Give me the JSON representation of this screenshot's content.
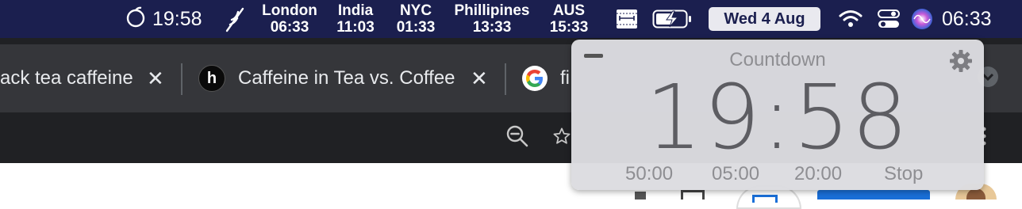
{
  "menubar": {
    "left_time": "19:58",
    "clocks": [
      {
        "city": "London",
        "time": "06:33"
      },
      {
        "city": "India",
        "time": "11:03"
      },
      {
        "city": "NYC",
        "time": "01:33"
      },
      {
        "city": "Phillipines",
        "time": "13:33"
      },
      {
        "city": "AUS",
        "time": "15:33"
      }
    ],
    "date": "Wed 4 Aug",
    "right_time": "06:33",
    "background": "#1b1f4f"
  },
  "browser": {
    "tabs": [
      {
        "title": "ack tea caffeine",
        "favicon": "none"
      },
      {
        "title": "Caffeine in Tea vs. Coffee",
        "favicon": "h-logo-icon"
      },
      {
        "title": "fi",
        "favicon": "google-icon"
      }
    ]
  },
  "countdown": {
    "title": "Countdown",
    "time": "19:58",
    "options": [
      "50:00",
      "05:00",
      "20:00",
      "Stop"
    ]
  }
}
